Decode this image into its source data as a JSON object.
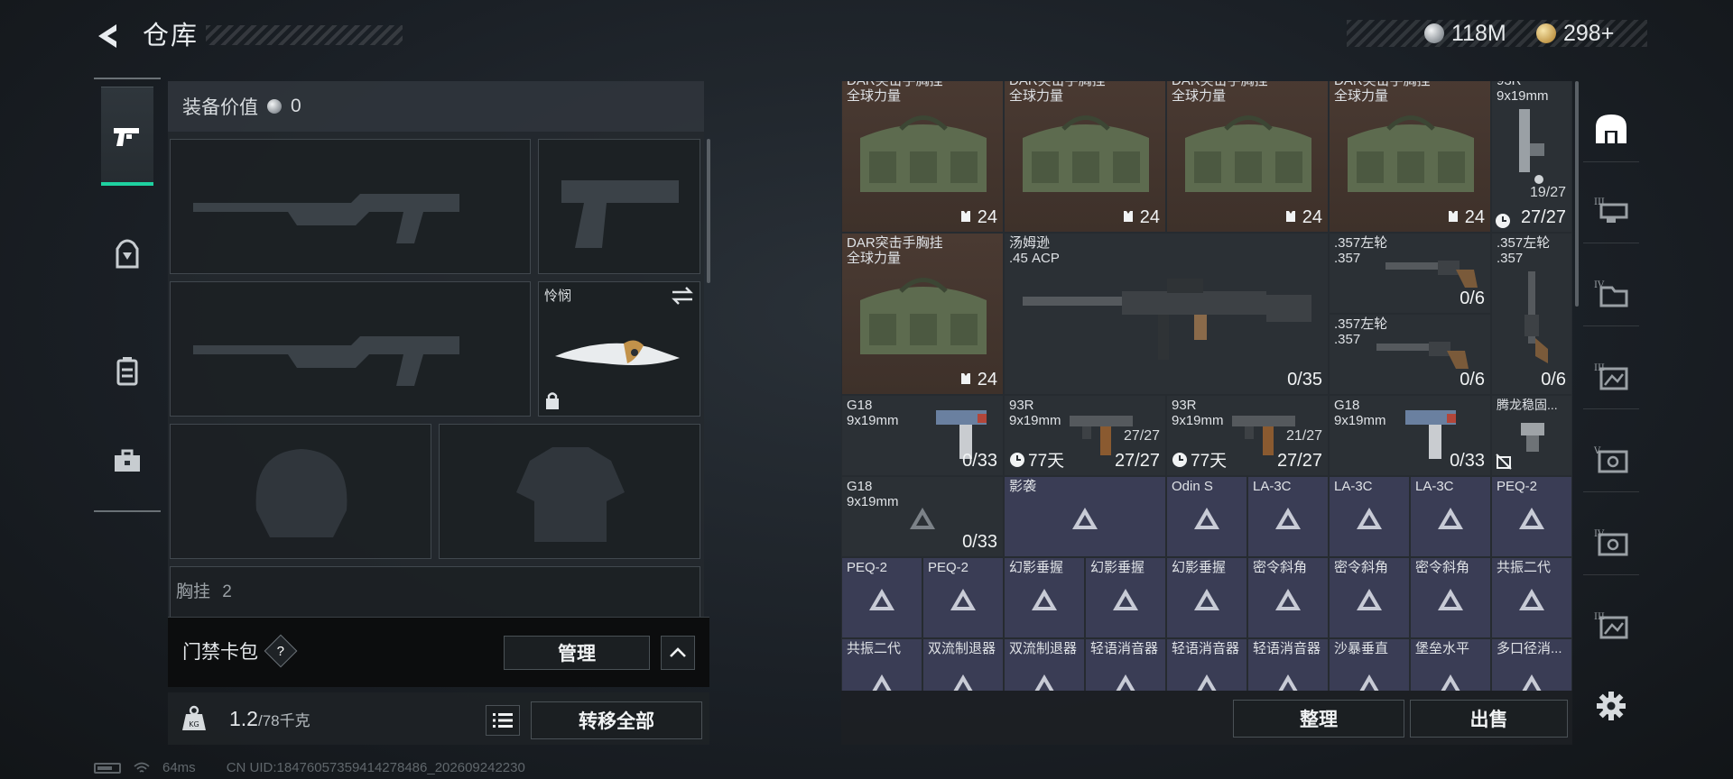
{
  "header": {
    "title": "仓库",
    "currencies": [
      {
        "icon": "silver-coin-icon",
        "value": "118M"
      },
      {
        "icon": "gold-coin-icon",
        "value": "298+"
      }
    ]
  },
  "side_tabs": [
    {
      "icon": "pistol-icon",
      "active": true
    },
    {
      "icon": "backpack-icon",
      "active": false
    },
    {
      "icon": "vest-icon",
      "active": false
    },
    {
      "icon": "toolbox-icon",
      "active": false
    }
  ],
  "equipment": {
    "value_label": "装备价值",
    "value": "0",
    "melee_name": "怜悯",
    "next_section": "胸挂",
    "next_section_count": "2"
  },
  "keycard": {
    "title": "门禁卡包",
    "help": "?",
    "manage_label": "管理"
  },
  "weight": {
    "current": "1.2",
    "max": "/78千克",
    "transfer_label": "转移全部"
  },
  "status": {
    "ping": "64ms",
    "uid": "CN UID:18476057359414278486_202609242230"
  },
  "stash": {
    "items": [
      {
        "name": "DAR突击手胸挂\n全球力量",
        "count": "24",
        "type": "bag"
      },
      {
        "name": "DAR突击手胸挂\n全球力量",
        "count": "24",
        "type": "bag"
      },
      {
        "name": "DAR突击手胸挂\n全球力量",
        "count": "24",
        "type": "bag"
      },
      {
        "name": "DAR突击手胸挂\n全球力量",
        "count": "24",
        "type": "bag"
      },
      {
        "name": "93R\n9x19mm",
        "count": "27/27",
        "extra": "19/27",
        "type": "pistol"
      },
      {
        "name": "DAR突击手胸挂\n全球力量",
        "count": "24",
        "type": "bag"
      },
      {
        "name": "汤姆逊\n.45 ACP",
        "count": "0/35",
        "type": "smg"
      },
      {
        "name": ".357左轮\n.357",
        "count": "0/6",
        "type": "revolver"
      },
      {
        "name": ".357左轮\n.357",
        "count": "0/6",
        "type": "revolver"
      },
      {
        "name": ".357左轮\n.357",
        "count": "0/6",
        "type": "revolver"
      },
      {
        "name": "G18\n9x19mm",
        "count": "0/33",
        "type": "pistol"
      },
      {
        "name": "93R\n9x19mm",
        "count": "27/27",
        "extra": "27/27",
        "timer": "77天",
        "type": "pistol"
      },
      {
        "name": "93R\n9x19mm",
        "count": "27/27",
        "extra": "21/27",
        "timer": "77天",
        "type": "pistol"
      },
      {
        "name": "G18\n9x19mm",
        "count": "0/33",
        "type": "pistol"
      },
      {
        "name": "腾龙稳固...",
        "type": "part"
      },
      {
        "name": "G18\n9x19mm",
        "count": "0/33",
        "type": "pistol"
      },
      {
        "name": "影袭",
        "type": "mod"
      },
      {
        "name": "Odin S",
        "type": "mod"
      },
      {
        "name": "LA-3C",
        "type": "mod"
      },
      {
        "name": "LA-3C",
        "type": "mod"
      },
      {
        "name": "LA-3C",
        "type": "mod"
      },
      {
        "name": "PEQ-2",
        "type": "mod"
      },
      {
        "name": "PEQ-2",
        "type": "mod"
      },
      {
        "name": "PEQ-2",
        "type": "mod"
      },
      {
        "name": "幻影垂握",
        "type": "mod"
      },
      {
        "name": "幻影垂握",
        "type": "mod"
      },
      {
        "name": "幻影垂握",
        "type": "mod"
      },
      {
        "name": "密令斜角",
        "type": "mod"
      },
      {
        "name": "密令斜角",
        "type": "mod"
      },
      {
        "name": "密令斜角",
        "type": "mod"
      },
      {
        "name": "共振二代",
        "type": "mod"
      },
      {
        "name": "共振二代",
        "type": "mod"
      },
      {
        "name": "双流制退器",
        "type": "mod"
      },
      {
        "name": "双流制退器",
        "type": "mod"
      },
      {
        "name": "轻语消音器",
        "type": "mod"
      },
      {
        "name": "轻语消音器",
        "type": "mod"
      },
      {
        "name": "轻语消音器",
        "type": "mod"
      },
      {
        "name": "沙暴垂直",
        "type": "mod"
      },
      {
        "name": "堡垒水平",
        "type": "mod"
      },
      {
        "name": "多口径消...",
        "type": "mod"
      }
    ],
    "sort_label": "整理",
    "sell_label": "出售"
  },
  "filter_rail": [
    {
      "icon": "all-items-icon",
      "active": true
    },
    {
      "icon": "vest-level-3-icon"
    },
    {
      "icon": "folder-level-4-icon"
    },
    {
      "icon": "image-level-3-icon"
    },
    {
      "icon": "safe-level-5-icon"
    },
    {
      "icon": "safe-level-4-icon"
    },
    {
      "icon": "image-level-3b-icon"
    }
  ],
  "colors": {
    "accent": "#1ed1a0",
    "rarity_brown": "#4a3a32",
    "rarity_purple": "#3a3d55",
    "rarity_gray": "#2b3035"
  }
}
